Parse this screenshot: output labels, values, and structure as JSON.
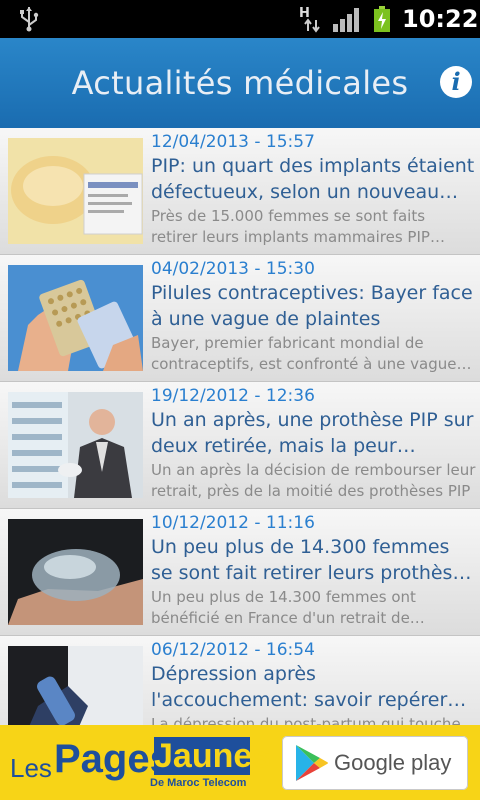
{
  "status_bar": {
    "time": "10:22",
    "icons": [
      "usb-icon",
      "data-transfer-icon",
      "signal-icon",
      "battery-charging-icon"
    ]
  },
  "app_bar": {
    "title": "Actualités médicales",
    "info_icon": "i"
  },
  "articles": [
    {
      "date": "12/04/2013 - 15:57",
      "headline": "PIP: un quart des implants étaient défectueux, selon un nouveau bilan",
      "summary": "Près de 15.000 femmes se sont faits retirer leurs implants mammaires PIP après le scandale",
      "thumb": "breast-implant-photo"
    },
    {
      "date": "04/02/2013 - 15:30",
      "headline": "Pilules contraceptives: Bayer face à une vague de plaintes",
      "summary": "Bayer, premier fabricant mondial de contraceptifs, est confronté à une vague de plaintes",
      "thumb": "contraceptive-pills-photo"
    },
    {
      "date": "19/12/2012 - 12:36",
      "headline": "Un an après, une prothèse PIP sur deux retirée, mais la peur subsiste",
      "summary": "Un an après la décision de rembourser leur retrait, près de la moitié des prothèses PIP",
      "thumb": "man-with-implant-photo"
    },
    {
      "date": "10/12/2012 - 11:16",
      "headline": "Un peu plus de 14.300 femmes se sont fait retirer leurs prothèses PIP",
      "summary": "Un peu plus de 14.300 femmes ont bénéficié en France d'un retrait de prothèses PIP",
      "thumb": "implant-in-hand-photo"
    },
    {
      "date": "06/12/2012 - 16:54",
      "headline": "Dépression après l'accouchement: savoir repérer les signaux d'alerte",
      "summary": "La dépression du post-partum qui touche",
      "thumb": "baby-bottle-photo"
    }
  ],
  "banner": {
    "pj_les": "Les",
    "pj_pages": "Pages",
    "pj_jaunes": "Jaunes",
    "pj_sub": "De Maroc Telecom",
    "store_label": "Google play"
  },
  "colors": {
    "app_bar": "#1a6cb0",
    "date": "#2a7fcf",
    "headline": "#2f5f94",
    "summary": "#8a8a8a",
    "banner_bg": "#f7d417"
  }
}
